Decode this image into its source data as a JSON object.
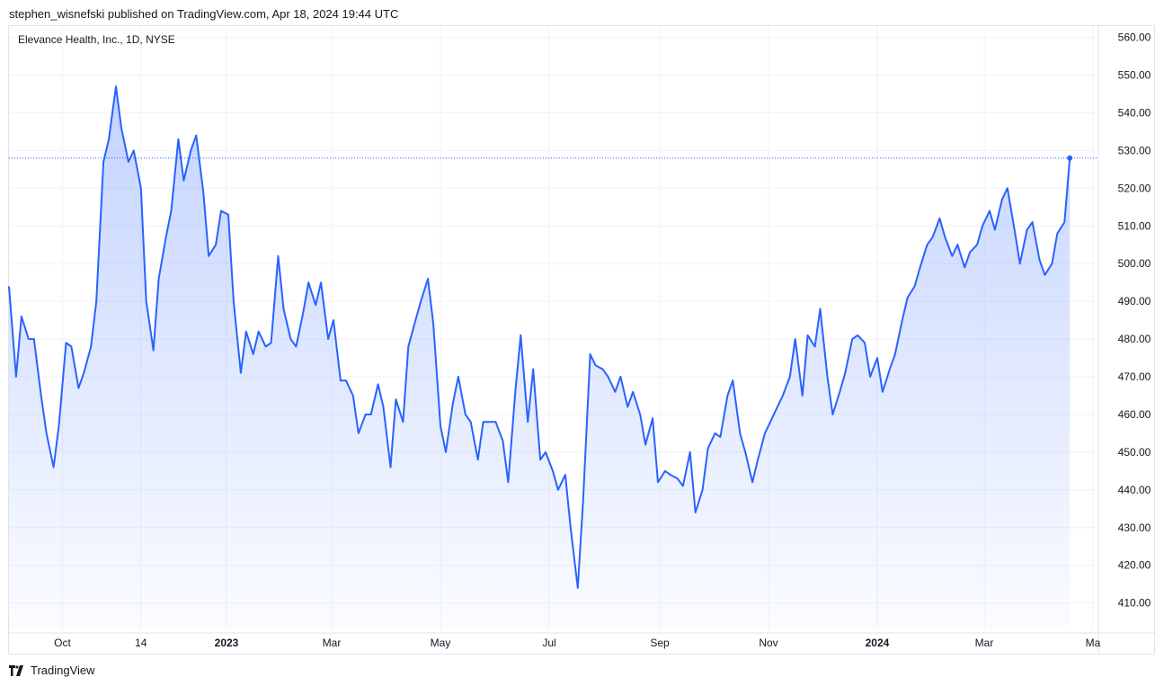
{
  "publisher_text": "stephen_wisnefski published on TradingView.com, Apr 18, 2024 19:44 UTC",
  "symbol_text": "Elevance Health, Inc., 1D, NYSE",
  "footer_brand": "TradingView",
  "colors": {
    "line": "#2962ff",
    "fill_top": "rgba(41,98,255,0.28)",
    "fill_bottom": "rgba(41,98,255,0.02)",
    "grid": "#f0f3fa",
    "axis_text": "#131722"
  },
  "chart_data": {
    "type": "area",
    "title": "Elevance Health, Inc., 1D, NYSE",
    "xlabel": "",
    "ylabel": "",
    "ylim": [
      403,
      563
    ],
    "grid": true,
    "last_value_marker": true,
    "y_ticks": [
      "560.00",
      "550.00",
      "540.00",
      "530.00",
      "520.00",
      "510.00",
      "500.00",
      "490.00",
      "480.00",
      "470.00",
      "460.00",
      "450.00",
      "440.00",
      "430.00",
      "420.00",
      "410.00"
    ],
    "x_ticks": [
      {
        "label": "Oct",
        "bold": false,
        "x": "2022-10-01"
      },
      {
        "label": "14",
        "bold": false,
        "x": "2022-11-14"
      },
      {
        "label": "2023",
        "bold": true,
        "x": "2023-01-01"
      },
      {
        "label": "Mar",
        "bold": false,
        "x": "2023-03-01"
      },
      {
        "label": "May",
        "bold": false,
        "x": "2023-05-01"
      },
      {
        "label": "Jul",
        "bold": false,
        "x": "2023-07-01"
      },
      {
        "label": "Sep",
        "bold": false,
        "x": "2023-09-01"
      },
      {
        "label": "Nov",
        "bold": false,
        "x": "2023-11-01"
      },
      {
        "label": "2024",
        "bold": true,
        "x": "2024-01-01"
      },
      {
        "label": "Mar",
        "bold": false,
        "x": "2024-03-01"
      },
      {
        "label": "Ma",
        "bold": false,
        "x": "2024-05-01"
      }
    ],
    "x_range": [
      "2022-09-01",
      "2024-05-01"
    ],
    "series": [
      {
        "points": [
          [
            "2022-09-01",
            494
          ],
          [
            "2022-09-05",
            470
          ],
          [
            "2022-09-08",
            486
          ],
          [
            "2022-09-12",
            480
          ],
          [
            "2022-09-15",
            480
          ],
          [
            "2022-09-19",
            465
          ],
          [
            "2022-09-22",
            455
          ],
          [
            "2022-09-26",
            446
          ],
          [
            "2022-09-29",
            457
          ],
          [
            "2022-10-03",
            479
          ],
          [
            "2022-10-06",
            478
          ],
          [
            "2022-10-10",
            467
          ],
          [
            "2022-10-13",
            471
          ],
          [
            "2022-10-17",
            478
          ],
          [
            "2022-10-20",
            490
          ],
          [
            "2022-10-24",
            527
          ],
          [
            "2022-10-27",
            533
          ],
          [
            "2022-10-31",
            547
          ],
          [
            "2022-11-03",
            536
          ],
          [
            "2022-11-07",
            527
          ],
          [
            "2022-11-10",
            530
          ],
          [
            "2022-11-14",
            520
          ],
          [
            "2022-11-17",
            490
          ],
          [
            "2022-11-21",
            477
          ],
          [
            "2022-11-24",
            496
          ],
          [
            "2022-11-28",
            507
          ],
          [
            "2022-12-01",
            514
          ],
          [
            "2022-12-05",
            533
          ],
          [
            "2022-12-08",
            522
          ],
          [
            "2022-12-12",
            530
          ],
          [
            "2022-12-15",
            534
          ],
          [
            "2022-12-19",
            519
          ],
          [
            "2022-12-22",
            502
          ],
          [
            "2022-12-26",
            505
          ],
          [
            "2022-12-29",
            514
          ],
          [
            "2023-01-02",
            513
          ],
          [
            "2023-01-05",
            490
          ],
          [
            "2023-01-09",
            471
          ],
          [
            "2023-01-12",
            482
          ],
          [
            "2023-01-16",
            476
          ],
          [
            "2023-01-19",
            482
          ],
          [
            "2023-01-23",
            478
          ],
          [
            "2023-01-26",
            479
          ],
          [
            "2023-01-30",
            502
          ],
          [
            "2023-02-02",
            488
          ],
          [
            "2023-02-06",
            480
          ],
          [
            "2023-02-09",
            478
          ],
          [
            "2023-02-13",
            487
          ],
          [
            "2023-02-16",
            495
          ],
          [
            "2023-02-20",
            489
          ],
          [
            "2023-02-23",
            495
          ],
          [
            "2023-02-27",
            480
          ],
          [
            "2023-03-02",
            485
          ],
          [
            "2023-03-06",
            469
          ],
          [
            "2023-03-09",
            469
          ],
          [
            "2023-03-13",
            465
          ],
          [
            "2023-03-16",
            455
          ],
          [
            "2023-03-20",
            460
          ],
          [
            "2023-03-23",
            460
          ],
          [
            "2023-03-27",
            468
          ],
          [
            "2023-03-30",
            462
          ],
          [
            "2023-04-03",
            446
          ],
          [
            "2023-04-06",
            464
          ],
          [
            "2023-04-10",
            458
          ],
          [
            "2023-04-13",
            478
          ],
          [
            "2023-04-17",
            485
          ],
          [
            "2023-04-20",
            490
          ],
          [
            "2023-04-24",
            496
          ],
          [
            "2023-04-27",
            484
          ],
          [
            "2023-05-01",
            457
          ],
          [
            "2023-05-04",
            450
          ],
          [
            "2023-05-08",
            463
          ],
          [
            "2023-05-11",
            470
          ],
          [
            "2023-05-15",
            460
          ],
          [
            "2023-05-18",
            458
          ],
          [
            "2023-05-22",
            448
          ],
          [
            "2023-05-25",
            458
          ],
          [
            "2023-05-29",
            458
          ],
          [
            "2023-06-01",
            458
          ],
          [
            "2023-06-05",
            453
          ],
          [
            "2023-06-08",
            442
          ],
          [
            "2023-06-12",
            466
          ],
          [
            "2023-06-15",
            481
          ],
          [
            "2023-06-19",
            458
          ],
          [
            "2023-06-22",
            472
          ],
          [
            "2023-06-26",
            448
          ],
          [
            "2023-06-29",
            450
          ],
          [
            "2023-07-03",
            445
          ],
          [
            "2023-07-06",
            440
          ],
          [
            "2023-07-10",
            444
          ],
          [
            "2023-07-13",
            430
          ],
          [
            "2023-07-17",
            414
          ],
          [
            "2023-07-20",
            437
          ],
          [
            "2023-07-24",
            476
          ],
          [
            "2023-07-27",
            473
          ],
          [
            "2023-07-31",
            472
          ],
          [
            "2023-08-03",
            470
          ],
          [
            "2023-08-07",
            466
          ],
          [
            "2023-08-10",
            470
          ],
          [
            "2023-08-14",
            462
          ],
          [
            "2023-08-17",
            466
          ],
          [
            "2023-08-21",
            460
          ],
          [
            "2023-08-24",
            452
          ],
          [
            "2023-08-28",
            459
          ],
          [
            "2023-08-31",
            442
          ],
          [
            "2023-09-04",
            445
          ],
          [
            "2023-09-07",
            444
          ],
          [
            "2023-09-11",
            443
          ],
          [
            "2023-09-14",
            441
          ],
          [
            "2023-09-18",
            450
          ],
          [
            "2023-09-21",
            434
          ],
          [
            "2023-09-25",
            440
          ],
          [
            "2023-09-28",
            451
          ],
          [
            "2023-10-02",
            455
          ],
          [
            "2023-10-05",
            454
          ],
          [
            "2023-10-09",
            465
          ],
          [
            "2023-10-12",
            469
          ],
          [
            "2023-10-16",
            455
          ],
          [
            "2023-10-19",
            450
          ],
          [
            "2023-10-23",
            442
          ],
          [
            "2023-10-26",
            448
          ],
          [
            "2023-10-30",
            455
          ],
          [
            "2023-11-02",
            458
          ],
          [
            "2023-11-06",
            462
          ],
          [
            "2023-11-09",
            465
          ],
          [
            "2023-11-13",
            470
          ],
          [
            "2023-11-16",
            480
          ],
          [
            "2023-11-20",
            465
          ],
          [
            "2023-11-23",
            481
          ],
          [
            "2023-11-27",
            478
          ],
          [
            "2023-11-30",
            488
          ],
          [
            "2023-12-04",
            470
          ],
          [
            "2023-12-07",
            460
          ],
          [
            "2023-12-11",
            466
          ],
          [
            "2023-12-14",
            471
          ],
          [
            "2023-12-18",
            480
          ],
          [
            "2023-12-21",
            481
          ],
          [
            "2023-12-25",
            479
          ],
          [
            "2023-12-28",
            470
          ],
          [
            "2024-01-01",
            475
          ],
          [
            "2024-01-04",
            466
          ],
          [
            "2024-01-08",
            472
          ],
          [
            "2024-01-11",
            476
          ],
          [
            "2024-01-15",
            485
          ],
          [
            "2024-01-18",
            491
          ],
          [
            "2024-01-22",
            494
          ],
          [
            "2024-01-25",
            499
          ],
          [
            "2024-01-29",
            505
          ],
          [
            "2024-02-01",
            507
          ],
          [
            "2024-02-05",
            512
          ],
          [
            "2024-02-08",
            507
          ],
          [
            "2024-02-12",
            502
          ],
          [
            "2024-02-15",
            505
          ],
          [
            "2024-02-19",
            499
          ],
          [
            "2024-02-22",
            503
          ],
          [
            "2024-02-26",
            505
          ],
          [
            "2024-02-29",
            510
          ],
          [
            "2024-03-04",
            514
          ],
          [
            "2024-03-07",
            509
          ],
          [
            "2024-03-11",
            517
          ],
          [
            "2024-03-14",
            520
          ],
          [
            "2024-03-18",
            509
          ],
          [
            "2024-03-21",
            500
          ],
          [
            "2024-03-25",
            509
          ],
          [
            "2024-03-28",
            511
          ],
          [
            "2024-04-01",
            501
          ],
          [
            "2024-04-04",
            497
          ],
          [
            "2024-04-08",
            500
          ],
          [
            "2024-04-11",
            508
          ],
          [
            "2024-04-15",
            511
          ],
          [
            "2024-04-18",
            528
          ]
        ]
      }
    ]
  }
}
